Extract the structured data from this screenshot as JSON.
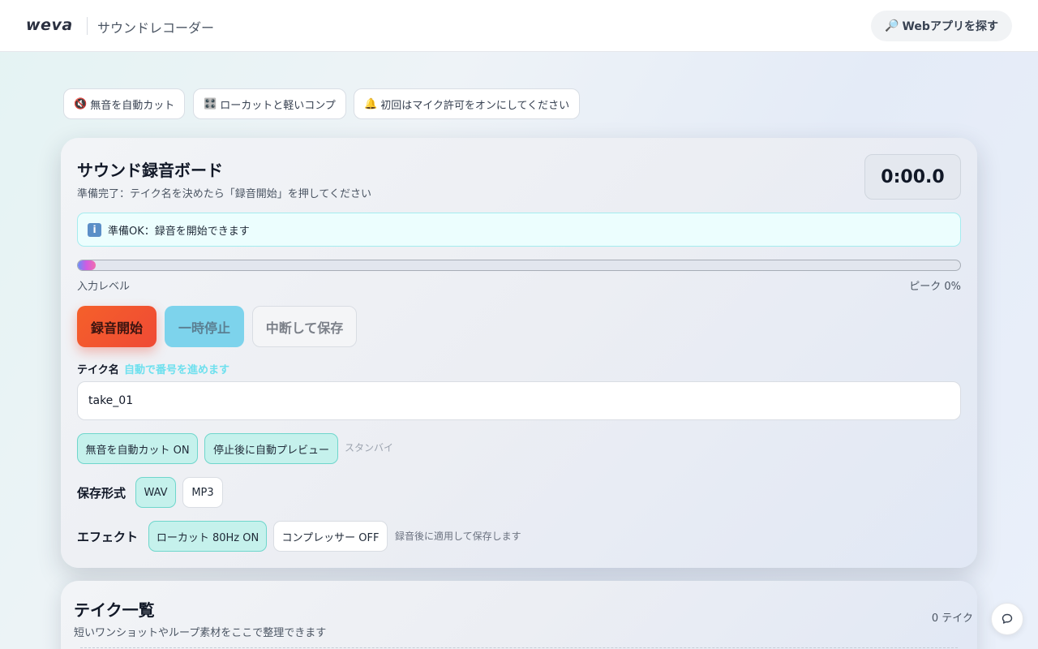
{
  "header": {
    "logo": "weva",
    "app_title": "サウンドレコーダー",
    "explore_icon": "🔎",
    "explore_label": "Webアプリを探す"
  },
  "chips": [
    {
      "icon": "🔇",
      "label": "無音を自動カット"
    },
    {
      "icon": "🎛️",
      "label": "ローカットと軽いコンプ"
    },
    {
      "icon": "🔔",
      "label": "初回はマイク許可をオンにしてください"
    }
  ],
  "recorder": {
    "title": "サウンド録音ボード",
    "subtitle": "準備完了：テイク名を決めたら「録音開始」を押してください",
    "timer": "0:00.0",
    "info_icon": "i",
    "info_text": "準備OK：録音を開始できます",
    "level_fraction": 0.02,
    "level_label": "入力レベル",
    "peak_label": "ピーク 0%",
    "record_label": "録音開始",
    "pause_label": "一時停止",
    "stop_label": "中断して保存",
    "take_label": "テイク名",
    "take_hint": "自動で番号を進めます",
    "take_value": "take_01",
    "toggle_silence": "無音を自動カット ON",
    "toggle_preview": "停止後に自動プレビュー",
    "status": "スタンバイ",
    "format_label": "保存形式",
    "format_wav": "WAV",
    "format_mp3": "MP3",
    "effect_label": "エフェクト",
    "effect_lowcut": "ローカット 80Hz ON",
    "effect_comp": "コンプレッサー OFF",
    "effect_note": "録音後に適用して保存します"
  },
  "takes": {
    "title": "テイク一覧",
    "subtitle": "短いワンショットやループ素材をここで整理できます",
    "count": "0 テイク"
  },
  "colors": {
    "record": "#f5602a",
    "pause": "#7dd3ec",
    "toggle_on": "#c5f1ec",
    "info_bg": "#ecfefe",
    "hint": "#6ee0ee"
  }
}
